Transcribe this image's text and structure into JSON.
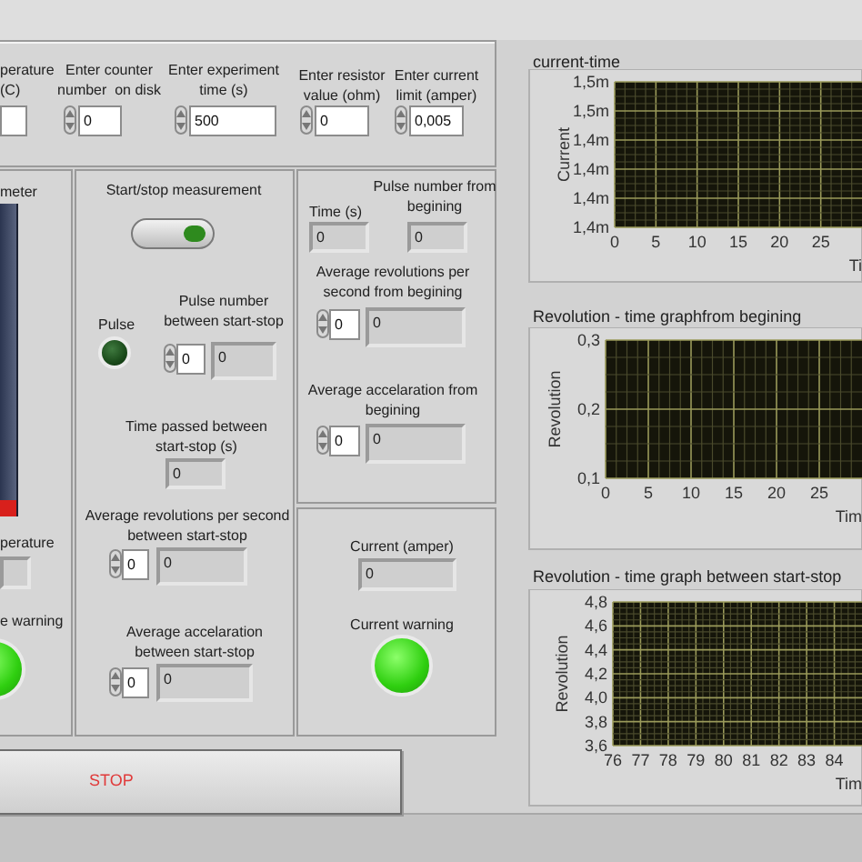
{
  "inputs": [
    {
      "label": "perature\n(C)"
    },
    {
      "label": "Enter counter\nnumber  on disk",
      "value": "0"
    },
    {
      "label": "Enter experiment\ntime (s)",
      "value": "500"
    },
    {
      "label": "Enter resistor\nvalue (ohm)",
      "value": "0"
    },
    {
      "label": "Enter current\nlimit (amper)",
      "value": "0,005"
    }
  ],
  "thermometer_panel": {
    "title": "meter",
    "level": 0.05,
    "temperature_label": "perature",
    "warning_label": "e warning",
    "warning_on": true
  },
  "measurement_panel": {
    "switch_label": "Start/stop measurement",
    "switch_on": true,
    "pulse_label": "Pulse",
    "pulse_on": false,
    "pulse_count": {
      "label": "Pulse number\nbetween start-stop",
      "control": "0",
      "indicator": "0"
    },
    "time_passed": {
      "label": "Time passed between\nstart-stop (s)",
      "value": "0"
    },
    "avg_revolutions": {
      "label": "Average revolutions per second\nbetween start-stop",
      "control": "0",
      "indicator": "0"
    },
    "avg_acceleration": {
      "label": "Average accelaration\nbetween start-stop",
      "control": "0",
      "indicator": "0"
    }
  },
  "totals_panel": {
    "time": {
      "label": "Time (s)",
      "value": "0"
    },
    "pulse_total": {
      "label": "Pulse number from\nbegining",
      "value": "0"
    },
    "avg_revolutions": {
      "label": "Average revolutions per\nsecond from begining",
      "control": "0",
      "indicator": "0"
    },
    "avg_acceleration": {
      "label": "Average accelaration from\nbegining",
      "control": "0",
      "indicator": "0"
    }
  },
  "current_panel": {
    "current": {
      "label": "Current (amper)",
      "value": "0"
    },
    "warning": {
      "label": "Current warning",
      "on": true
    }
  },
  "stop_button": "STOP",
  "graphs": [
    {
      "title": "current-time",
      "chart_data": {
        "type": "line",
        "ylabel": "Current",
        "xlabel": "Ti",
        "grid": true,
        "xlim": [
          0,
          30
        ],
        "ylim": [
          1.38,
          1.48
        ],
        "xticks": [
          0,
          5,
          10,
          15,
          20,
          25
        ],
        "yticks": [
          {
            "value": 1.48,
            "label": "1,5m"
          },
          {
            "value": 1.46,
            "label": "1,5m"
          },
          {
            "value": 1.44,
            "label": "1,4m"
          },
          {
            "value": 1.42,
            "label": "1,4m"
          },
          {
            "value": 1.4,
            "label": "1,4m"
          },
          {
            "value": 1.38,
            "label": "1,4m"
          }
        ]
      }
    },
    {
      "title": "Revolution - time graphfrom begining",
      "chart_data": {
        "type": "line",
        "ylabel": "Revolution",
        "xlabel": "Tim",
        "grid": true,
        "xlim": [
          0,
          30
        ],
        "ylim": [
          0.1,
          0.3
        ],
        "xticks": [
          0,
          5,
          10,
          15,
          20,
          25
        ],
        "yticks": [
          {
            "value": 0.3,
            "label": "0,3"
          },
          {
            "value": 0.2,
            "label": "0,2"
          },
          {
            "value": 0.1,
            "label": "0,1"
          }
        ]
      }
    },
    {
      "title": "Revolution - time graph between start-stop",
      "chart_data": {
        "type": "line",
        "ylabel": "Revolution",
        "xlabel": "Tim",
        "grid": true,
        "xlim": [
          76,
          85
        ],
        "ylim": [
          3.6,
          4.8
        ],
        "xticks": [
          76,
          77,
          78,
          79,
          80,
          81,
          82,
          83,
          84
        ],
        "yticks": [
          {
            "value": 4.8,
            "label": "4,8"
          },
          {
            "value": 4.6,
            "label": "4,6"
          },
          {
            "value": 4.4,
            "label": "4,4"
          },
          {
            "value": 4.2,
            "label": "4,2"
          },
          {
            "value": 4.0,
            "label": "4,0"
          },
          {
            "value": 3.8,
            "label": "3,8"
          },
          {
            "value": 3.6,
            "label": "3,6"
          }
        ]
      }
    }
  ]
}
